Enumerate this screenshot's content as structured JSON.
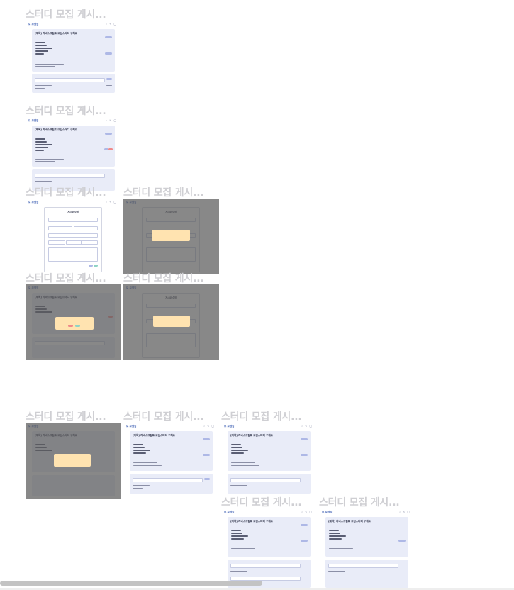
{
  "frames": [
    {
      "title": "스터디 모집 게시..."
    },
    {
      "title": "스터디 모집 게시..."
    },
    {
      "title": "스터디 모집 게시..."
    },
    {
      "title": "스터디 모집 게시..."
    },
    {
      "title": "스터디 모집 게시..."
    },
    {
      "title": "스터디 모집 게시..."
    },
    {
      "title": "스터디 모집 게시..."
    },
    {
      "title": "스터디 모집 게시..."
    },
    {
      "title": "스터디 모집 게시..."
    },
    {
      "title": "스터디 모집 게시..."
    },
    {
      "title": "스터디 모집 게시..."
    }
  ],
  "mock": {
    "logo": "모 모였임",
    "post_title": "[제목] 자바스크립트 모임스터디 구해요",
    "form_title": "게시글 수정",
    "icons": "⌕ ✎ ◯"
  },
  "colors": {
    "dim_overlay": "#5a5a5a",
    "card": "#e9ecf8",
    "modal": "#ffe3b0",
    "pill": "#aeb8e6",
    "danger": "#f08a8a",
    "ok": "#8fd3c5"
  }
}
